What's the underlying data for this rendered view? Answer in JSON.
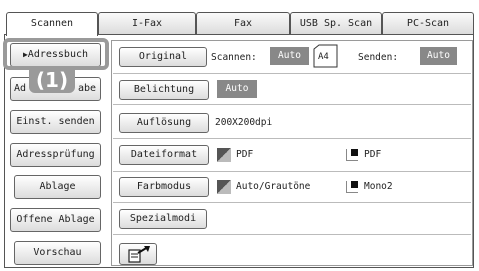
{
  "tabs": [
    {
      "label": "Scannen",
      "active": true
    },
    {
      "label": "I-Fax",
      "active": false
    },
    {
      "label": "Fax",
      "active": false
    },
    {
      "label": "USB Sp. Scan",
      "active": false
    },
    {
      "label": "PC-Scan",
      "active": false
    }
  ],
  "sidebar": {
    "address_book": "Adressbuch",
    "address_entry_partial_1": "Ad",
    "address_entry_partial_2": "abe",
    "one_touch_send": "Einst. senden",
    "address_check": "Adressprüfung",
    "file": "Ablage",
    "open_file": "Offene Ablage",
    "preview": "Vorschau"
  },
  "callout": {
    "label": "(1)"
  },
  "settings": {
    "original": {
      "button": "Original",
      "scan_label": "Scannen:",
      "scan_value": "Auto",
      "paper_size": "A4",
      "send_label": "Senden:",
      "send_value": "Auto"
    },
    "exposure": {
      "button": "Belichtung",
      "value": "Auto"
    },
    "resolution": {
      "button": "Auflösung",
      "value": "200X200dpi"
    },
    "file_format": {
      "button": "Dateiformat",
      "color_value": "PDF",
      "mono_value": "PDF"
    },
    "color_mode": {
      "button": "Farbmodus",
      "color_value": "Auto/Grautöne",
      "mono_value": "Mono2"
    },
    "special_modes": {
      "button": "Spezialmodi"
    }
  },
  "icons": {
    "send_icon": "scanner-send-arrow-icon",
    "color_swatch": "color-mode-icon",
    "mono_swatch": "mono-mode-icon"
  },
  "colors": {
    "value_box": "#888888",
    "callout": "#9a9a9a"
  }
}
